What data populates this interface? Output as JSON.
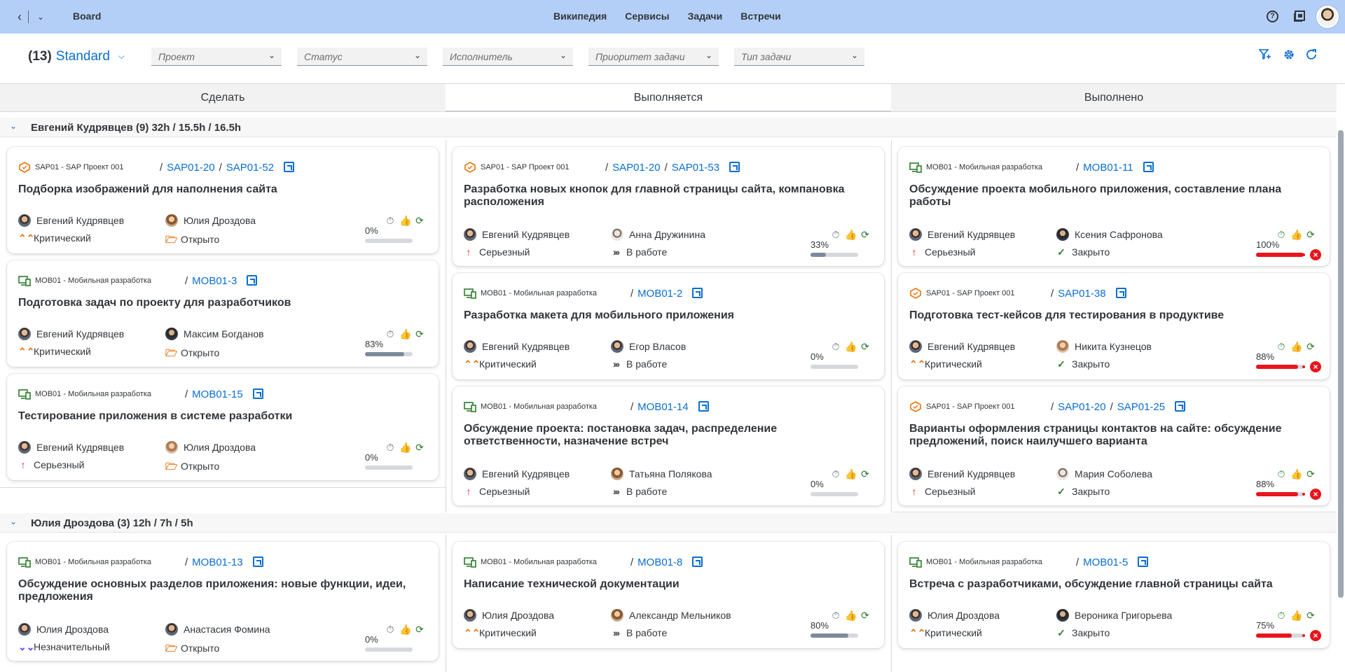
{
  "shell": {
    "title": "Board",
    "nav": [
      "Википедия",
      "Сервисы",
      "Задачи",
      "Встречи"
    ],
    "help": "?"
  },
  "variant": {
    "count": "(13)",
    "name": "Standard"
  },
  "filters": [
    "Проект",
    "Статус",
    "Исполнитель",
    "Приоритет задачи",
    "Тип задачи"
  ],
  "columns": [
    "Сделать",
    "Выполняется",
    "Выполнено"
  ],
  "groups": [
    {
      "label": "Евгений Кудрявцев (9) 32h / 15.5h / 16.5h"
    },
    {
      "label": "Юлия Дроздова (3) 12h / 7h / 5h"
    }
  ],
  "cards": [
    {
      "project": "SAP01 - SAP Проект 001",
      "links": [
        "SAP01-20",
        "SAP01-52"
      ],
      "title": "Подборка изображений для наполнения сайта",
      "title2": "",
      "owner": "Евгений Кудрявцев",
      "assignee": "Юлия Дроздова",
      "priority": "Критический",
      "status": "Открыто",
      "progress": "0%",
      "progress_value": 0
    },
    {
      "project": "MOB01 - Мобильная разработка",
      "links": [
        "MOB01-3"
      ],
      "title": "Подготовка задач по проекту для разработчиков",
      "title2": "",
      "owner": "Евгений Кудрявцев",
      "assignee": "Максим Богданов",
      "priority": "Критический",
      "status": "Открыто",
      "progress": "83%",
      "progress_value": 83
    },
    {
      "project": "MOB01 - Мобильная разработка",
      "links": [
        "MOB01-15"
      ],
      "title": "Тестирование приложения в системе разработки",
      "title2": "",
      "owner": "Евгений Кудрявцев",
      "assignee": "Юлия Дроздова",
      "priority": "Серьезный",
      "status": "Открыто",
      "progress": "0%",
      "progress_value": 0
    },
    {
      "project": "SAP01 - SAP Проект 001",
      "links": [
        "SAP01-20",
        "SAP01-53"
      ],
      "title": "Разработка новых кнопок для главной страницы сайта, компановка",
      "title2": "расположения",
      "owner": "Евгений Кудрявцев",
      "assignee": "Анна Дружинина",
      "priority": "Серьезный",
      "status": "В работе",
      "progress": "33%",
      "progress_value": 33
    },
    {
      "project": "MOB01 - Мобильная разработка",
      "links": [
        "MOB01-2"
      ],
      "title": "Разработка макета для мобильного приложения",
      "title2": "",
      "owner": "Евгений Кудрявцев",
      "assignee": "Егор Власов",
      "priority": "Критический",
      "status": "В работе",
      "progress": "0%",
      "progress_value": 0
    },
    {
      "project": "MOB01 - Мобильная разработка",
      "links": [
        "MOB01-14"
      ],
      "title": "Обсуждение проекта: постановка задач, распределение",
      "title2": "ответственности, назначение встреч",
      "owner": "Евгений Кудрявцев",
      "assignee": "Татьяна Полякова",
      "priority": "Серьезный",
      "status": "В работе",
      "progress": "0%",
      "progress_value": 0
    },
    {
      "project": "MOB01 - Мобильная разработка",
      "links": [
        "MOB01-11"
      ],
      "title": "Обсуждение проекта мобильного приложения, составление плана",
      "title2": "работы",
      "owner": "Евгений Кудрявцев",
      "assignee": "Ксения Сафронова",
      "priority": "Серьезный",
      "status": "Закрыто",
      "progress": "100%",
      "progress_value": 100
    },
    {
      "project": "SAP01 - SAP Проект 001",
      "links": [
        "SAP01-38"
      ],
      "title": "Подготовка тест-кейсов для тестирования в продуктиве",
      "title2": "",
      "owner": "Евгений Кудрявцев",
      "assignee": "Никита Кузнецов",
      "priority": "Критический",
      "status": "Закрыто",
      "progress": "88%",
      "progress_value": 88
    },
    {
      "project": "SAP01 - SAP Проект 001",
      "links": [
        "SAP01-20",
        "SAP01-25"
      ],
      "title": "Варианты оформления страницы контактов на сайте: обсуждение",
      "title2": "предложений, поиск наилучшего варианта",
      "owner": "Евгений Кудрявцев",
      "assignee": "Мария Соболева",
      "priority": "Серьезный",
      "status": "Закрыто",
      "progress": "88%",
      "progress_value": 88
    },
    {
      "project": "MOB01 - Мобильная разработка",
      "links": [
        "MOB01-13"
      ],
      "title": "Обсуждение основных разделов приложения: новые функции, идеи,",
      "title2": "предложения",
      "owner": "Юлия Дроздова",
      "assignee": "Анастасия Фомина",
      "priority": "Незначительный",
      "status": "Открыто",
      "progress": "0%",
      "progress_value": 0
    },
    {
      "project": "MOB01 - Мобильная разработка",
      "links": [
        "MOB01-8"
      ],
      "title": "Написание технической документации",
      "title2": "",
      "owner": "Юлия Дроздова",
      "assignee": "Александр Мельников",
      "priority": "Критический",
      "status": "В работе",
      "progress": "80%",
      "progress_value": 80
    },
    {
      "project": "MOB01 - Мобильная разработка",
      "links": [
        "MOB01-5"
      ],
      "title": "Встреча с разработчиками, обсуждение главной страницы сайта",
      "title2": "",
      "owner": "Юлия Дроздова",
      "assignee": "Вероника Григорьева",
      "priority": "Критический",
      "status": "Закрыто",
      "progress": "75%",
      "progress_value": 75
    }
  ]
}
